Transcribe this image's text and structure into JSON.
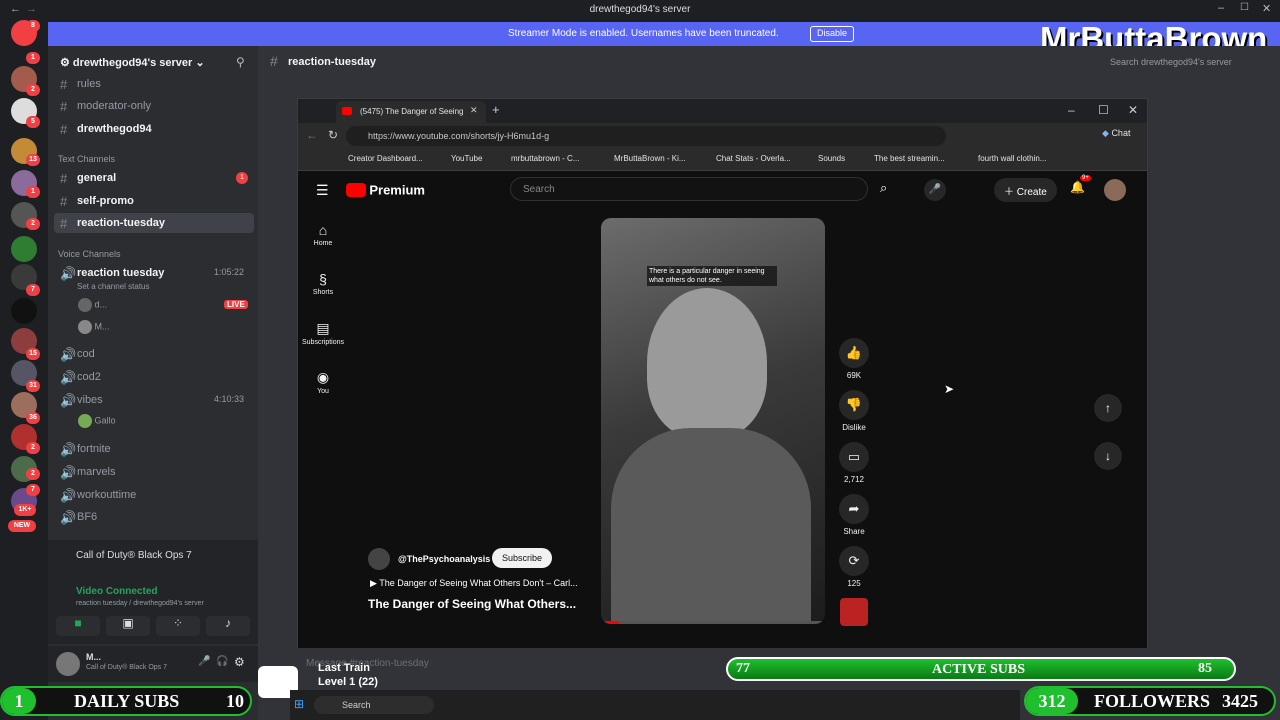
{
  "window": {
    "title": "drewthegod94's server"
  },
  "streamer": {
    "message": "Streamer Mode is enabled. Usernames have been truncated.",
    "disable": "Disable"
  },
  "overlay_name": "MrButtaBrown",
  "server": {
    "name": "drewthegod94's server"
  },
  "channels": {
    "top": [
      {
        "name": "rules"
      },
      {
        "name": "moderator-only"
      },
      {
        "name": "drewthegod94"
      }
    ],
    "text_header": "Text Channels",
    "text": [
      {
        "name": "general",
        "badge": "1"
      },
      {
        "name": "self-promo"
      },
      {
        "name": "reaction-tuesday"
      }
    ],
    "voice_header": "Voice Channels",
    "voice_main": {
      "name": "reaction tuesday",
      "time": "1:05:22",
      "status": "Set a channel status"
    },
    "voice_users": [
      {
        "name": "d...",
        "live": "LIVE"
      },
      {
        "name": "M..."
      }
    ],
    "voice_more": [
      {
        "name": "cod"
      },
      {
        "name": "cod2"
      },
      {
        "name": "vibes",
        "time": "4:10:33"
      }
    ],
    "vibes_user": "Gallo",
    "voice_rest": [
      {
        "name": "fortnite"
      },
      {
        "name": "marvels"
      },
      {
        "name": "workouttime"
      },
      {
        "name": "BF6"
      }
    ]
  },
  "rail_badges": [
    "8",
    "1",
    "2",
    "5",
    "13",
    "1",
    "2",
    "7",
    "15",
    "31",
    "36",
    "2",
    "2",
    "7",
    "1K+",
    "NEW"
  ],
  "activity": {
    "game": "Call of Duty® Black Ops 7",
    "connected": "Video Connected",
    "path": "reaction tuesday / drewthegod94's server"
  },
  "user": {
    "name": "M...",
    "status": "Call of Duty® Black Ops 7"
  },
  "channel_header": {
    "name": "reaction-tuesday",
    "search": "Search drewthegod94's server"
  },
  "browser": {
    "tab": "(5475) The Danger of Seeing",
    "url": "https://www.youtube.com/shorts/jy-H6mu1d-g",
    "chat": "Chat",
    "bookmarks": [
      "Creator Dashboard...",
      "YouTube",
      "mrbuttabrown - C...",
      "MrButtaBrown - Ki...",
      "Chat Stats - Overla...",
      "Sounds",
      "The best streamin...",
      "fourth wall clothin..."
    ]
  },
  "youtube": {
    "logo": "Premium",
    "search": "Search",
    "create": "Create",
    "notif": "9+",
    "nav": [
      "Home",
      "Shorts",
      "Subscriptions",
      "You"
    ],
    "caption": "There is a particular danger in seeing what others do not see.",
    "likes": "69K",
    "dislike": "Dislike",
    "comments": "2,712",
    "share": "Share",
    "remix": "125",
    "channel": "@ThePsychoanalysis",
    "subscribe": "Subscribe",
    "playlist": "The Danger of Seeing What Others Don't – Carl...",
    "title": "The Danger of Seeing What Others..."
  },
  "bottom": {
    "subs_now": "77",
    "active_label": "ACTIVE SUBS",
    "active_goal": "85",
    "daily_now": "1",
    "daily_label": "DAILY SUBS",
    "daily_goal": "10",
    "fol_now": "312",
    "fol_label": "FOLLOWERS",
    "fol_goal": "3425",
    "song": "Last Train",
    "level": "Level 1  (22)",
    "taskbar_search": "Search",
    "message_placeholder": "Message #reaction-tuesday"
  },
  "colors": {
    "discord_blurple": "#5865f2",
    "yt_red": "#ff0000",
    "green_bar": "#1fbf2e"
  }
}
